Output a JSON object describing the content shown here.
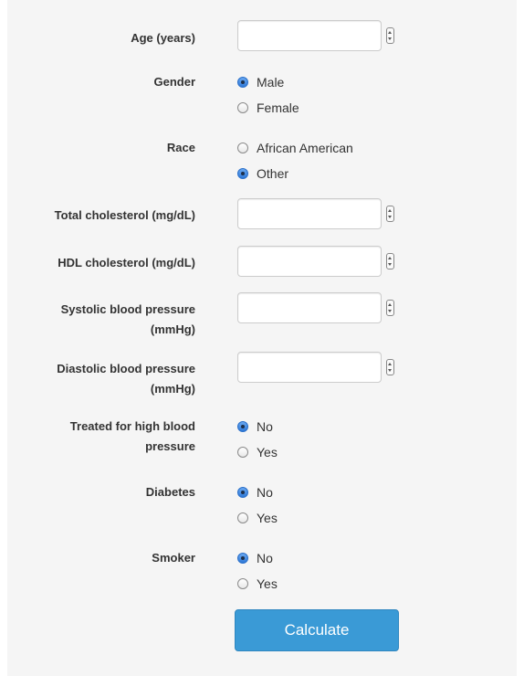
{
  "fields": {
    "age": {
      "label": "Age (years)",
      "value": ""
    },
    "gender": {
      "label": "Gender",
      "options": [
        "Male",
        "Female"
      ],
      "selected": "Male"
    },
    "race": {
      "label": "Race",
      "options": [
        "African American",
        "Other"
      ],
      "selected": "Other"
    },
    "total_cholesterol": {
      "label": "Total cholesterol (mg/dL)",
      "value": ""
    },
    "hdl_cholesterol": {
      "label": "HDL cholesterol (mg/dL)",
      "value": ""
    },
    "systolic_bp": {
      "label": "Systolic blood pressure (mmHg)",
      "value": ""
    },
    "diastolic_bp": {
      "label": "Diastolic blood pressure (mmHg)",
      "value": ""
    },
    "treated_bp": {
      "label": "Treated for high blood pressure",
      "options": [
        "No",
        "Yes"
      ],
      "selected": "No"
    },
    "diabetes": {
      "label": "Diabetes",
      "options": [
        "No",
        "Yes"
      ],
      "selected": "No"
    },
    "smoker": {
      "label": "Smoker",
      "options": [
        "No",
        "Yes"
      ],
      "selected": "No"
    }
  },
  "calculate_label": "Calculate",
  "colors": {
    "button": "#3a9ad6",
    "panel": "#f5f5f5",
    "radio_checked": "#2f79d8"
  }
}
